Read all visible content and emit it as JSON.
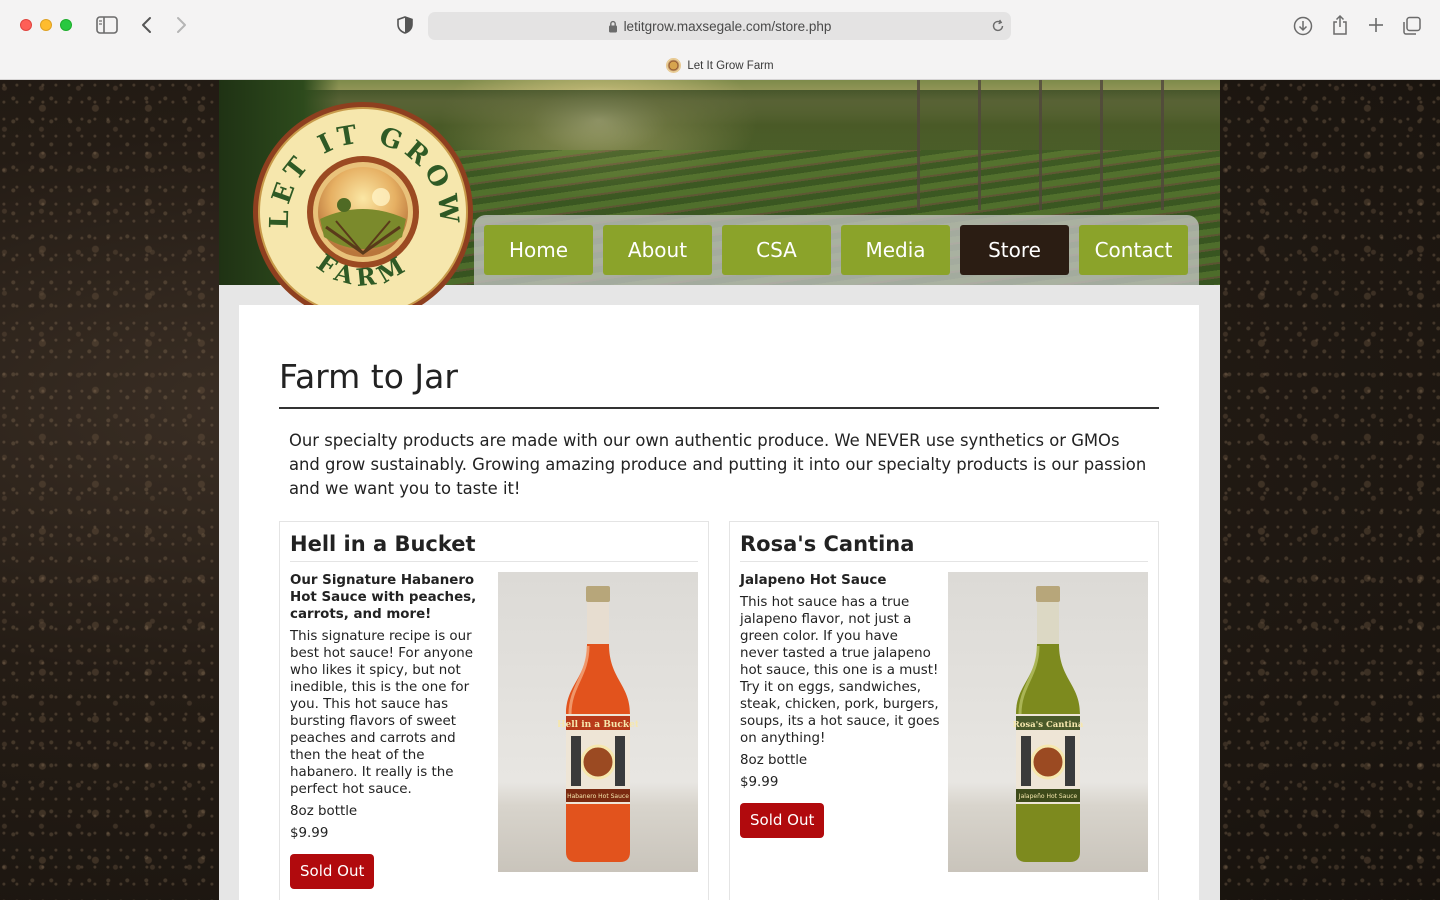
{
  "browser": {
    "url": "letitgrow.maxsegale.com/store.php",
    "tab_title": "Let It Grow Farm"
  },
  "logo": {
    "top_text": "LET IT GROW",
    "bottom_text": "FARM"
  },
  "nav": {
    "items": [
      {
        "label": "Home",
        "active": false
      },
      {
        "label": "About",
        "active": false
      },
      {
        "label": "CSA",
        "active": false
      },
      {
        "label": "Media",
        "active": false
      },
      {
        "label": "Store",
        "active": true
      },
      {
        "label": "Contact",
        "active": false
      }
    ]
  },
  "page": {
    "title": "Farm to Jar",
    "intro": "Our specialty products are made with our own authentic produce. We NEVER use synthetics or GMOs and grow sustainably. Growing amazing produce and putting it into our specialty products is our passion and we want you to taste it!"
  },
  "products": [
    {
      "name": "Hell in a Bucket",
      "subtitle": "Our Signature Habanero Hot Sauce with peaches, carrots, and more!",
      "description": "This signature recipe is our best hot sauce! For anyone who likes it spicy, but not inedible, this is the one for you. This hot sauce has bursting flavors of sweet peaches and carrots and then the heat of the habanero. It really is the perfect hot sauce.",
      "size": "8oz bottle",
      "price": "$9.99",
      "button": "Sold Out",
      "label_top": "Hell in a Bucket",
      "label_bottom": "Habanero Hot Sauce",
      "sauce_color": "#e2531d"
    },
    {
      "name": "Rosa's Cantina",
      "subtitle": "Jalapeno Hot Sauce",
      "description": "This hot sauce has a true jalapeno flavor, not just a green color. If you have never tasted a true jalapeno hot sauce, this one is a must! Try it on eggs, sandwiches, steak, chicken, pork, burgers, soups, its a hot sauce, it goes on anything!",
      "size": "8oz bottle",
      "price": "$9.99",
      "button": "Sold Out",
      "label_top": "Rosa's Cantina",
      "label_bottom": "Jalapeño Hot Sauce",
      "sauce_color": "#7d8a1e"
    }
  ],
  "colors": {
    "nav_green": "#8ba32a",
    "nav_active": "#2b1d13",
    "sold_out_red": "#b10a0d"
  }
}
